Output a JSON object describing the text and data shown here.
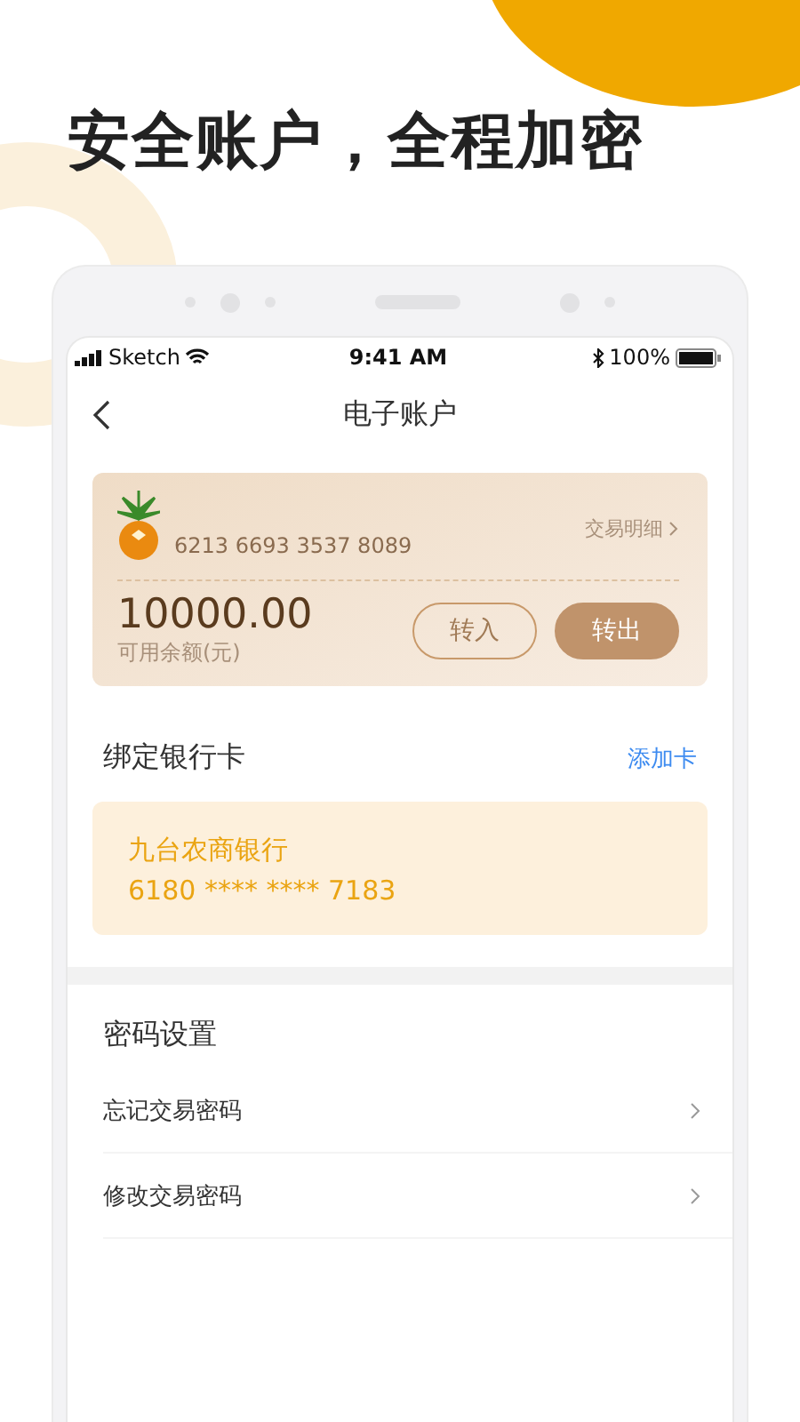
{
  "headline": "安全账户，全程加密",
  "status_bar": {
    "carrier": "Sketch",
    "time": "9:41 AM",
    "battery": "100%"
  },
  "nav": {
    "title": "电子账户"
  },
  "account_card": {
    "card_number": "6213 6693 3537 8089",
    "details_link": "交易明细",
    "balance": "10000.00",
    "balance_label": "可用余额(元)",
    "buttons": [
      {
        "label": "转入",
        "kind": "outline"
      },
      {
        "label": "转出",
        "kind": "filled"
      }
    ]
  },
  "bound_cards": {
    "title": "绑定银行卡",
    "add_link": "添加卡",
    "cards": [
      {
        "bank": "九台农商银行",
        "number": "6180 **** **** 7183"
      }
    ]
  },
  "password_settings": {
    "title": "密码设置",
    "items": [
      "忘记交易密码",
      "修改交易密码"
    ]
  }
}
